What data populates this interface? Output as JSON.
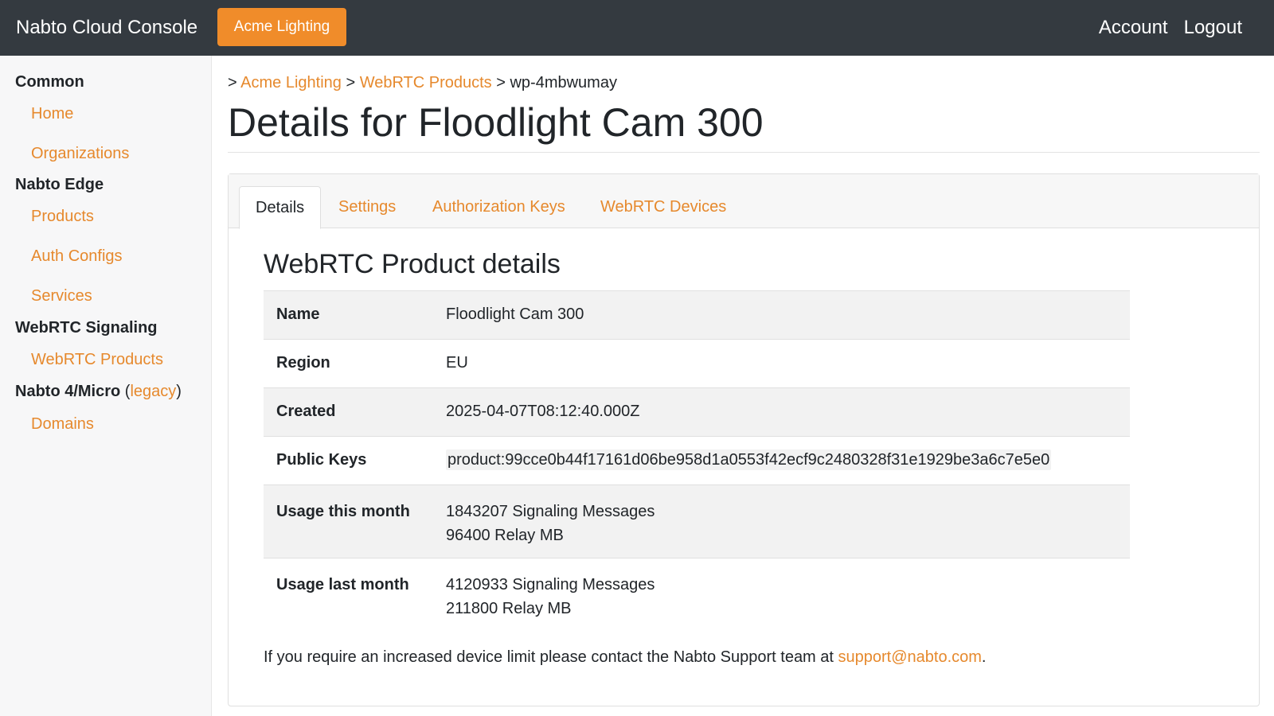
{
  "header": {
    "brand": "Nabto Cloud Console",
    "org_button": "Acme Lighting",
    "account": "Account",
    "logout": "Logout"
  },
  "sidebar": {
    "common_heading": "Common",
    "home": "Home",
    "organizations": "Organizations",
    "edge_heading": "Nabto Edge",
    "products": "Products",
    "auth_configs": "Auth Configs",
    "services": "Services",
    "webrtc_heading": "WebRTC Signaling",
    "webrtc_products": "WebRTC Products",
    "legacy_heading": "Nabto 4/Micro",
    "legacy_open": " (",
    "legacy_link": "legacy",
    "legacy_close": ")",
    "domains": "Domains"
  },
  "breadcrumb": {
    "prefix": "> ",
    "org": "Acme Lighting",
    "sep": " > ",
    "section": "WebRTC Products",
    "current": "wp-4mbwumay"
  },
  "page_title": "Details for Floodlight Cam 300",
  "tabs": {
    "details": "Details",
    "settings": "Settings",
    "auth_keys": "Authorization Keys",
    "devices": "WebRTC Devices"
  },
  "section_title": "WebRTC Product details",
  "details": {
    "name_label": "Name",
    "name_value": "Floodlight Cam 300",
    "region_label": "Region",
    "region_value": "EU",
    "created_label": "Created",
    "created_value": "2025-04-07T08:12:40.000Z",
    "keys_label": "Public Keys",
    "keys_value": "product:99cce0b44f17161d06be958d1a0553f42ecf9c2480328f31e1929be3a6c7e5e0",
    "usage_this_label": "Usage this month",
    "usage_this_signaling": "1843207 Signaling Messages",
    "usage_this_relay": "96400 Relay MB",
    "usage_last_label": "Usage last month",
    "usage_last_signaling": "4120933 Signaling Messages",
    "usage_last_relay": "211800 Relay MB"
  },
  "footer": {
    "text": "If you require an increased device limit please contact the Nabto Support team at ",
    "email": "support@nabto.com",
    "period": "."
  },
  "colors": {
    "accent": "#e6892d",
    "navbar": "#343a40",
    "org_button": "#f08c2a"
  }
}
